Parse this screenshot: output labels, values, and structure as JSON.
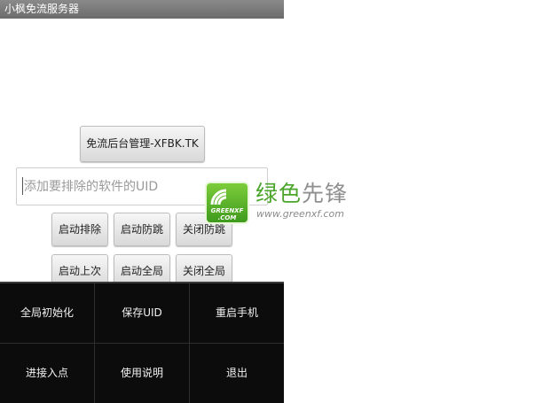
{
  "window": {
    "title": "小枫免流服务器"
  },
  "main": {
    "admin_button": "免流后台管理-XFBK.TK",
    "uid_input": {
      "value": "",
      "placeholder": "添加要排除的软件的UID"
    },
    "button_grid": [
      [
        "启动排除",
        "启动防跳",
        "关闭防跳"
      ],
      [
        "启动上次",
        "启动全局",
        "关闭全局"
      ]
    ]
  },
  "options_menu": {
    "items": [
      [
        "全局初始化",
        "保存UID",
        "重启手机"
      ],
      [
        "进接入点",
        "使用说明",
        "退出"
      ]
    ]
  },
  "watermark": {
    "logo_text_1": "GREENXF",
    "logo_text_2": ".COM",
    "title_green": "绿色",
    "title_gray": "先锋",
    "url": "www.greenxf.com",
    "colors": {
      "green": "#4aa52a",
      "gray": "#8f8f8f"
    }
  },
  "colors": {
    "titlebar": "#7a7a7a",
    "menu_bg": "#0c0c0c"
  }
}
